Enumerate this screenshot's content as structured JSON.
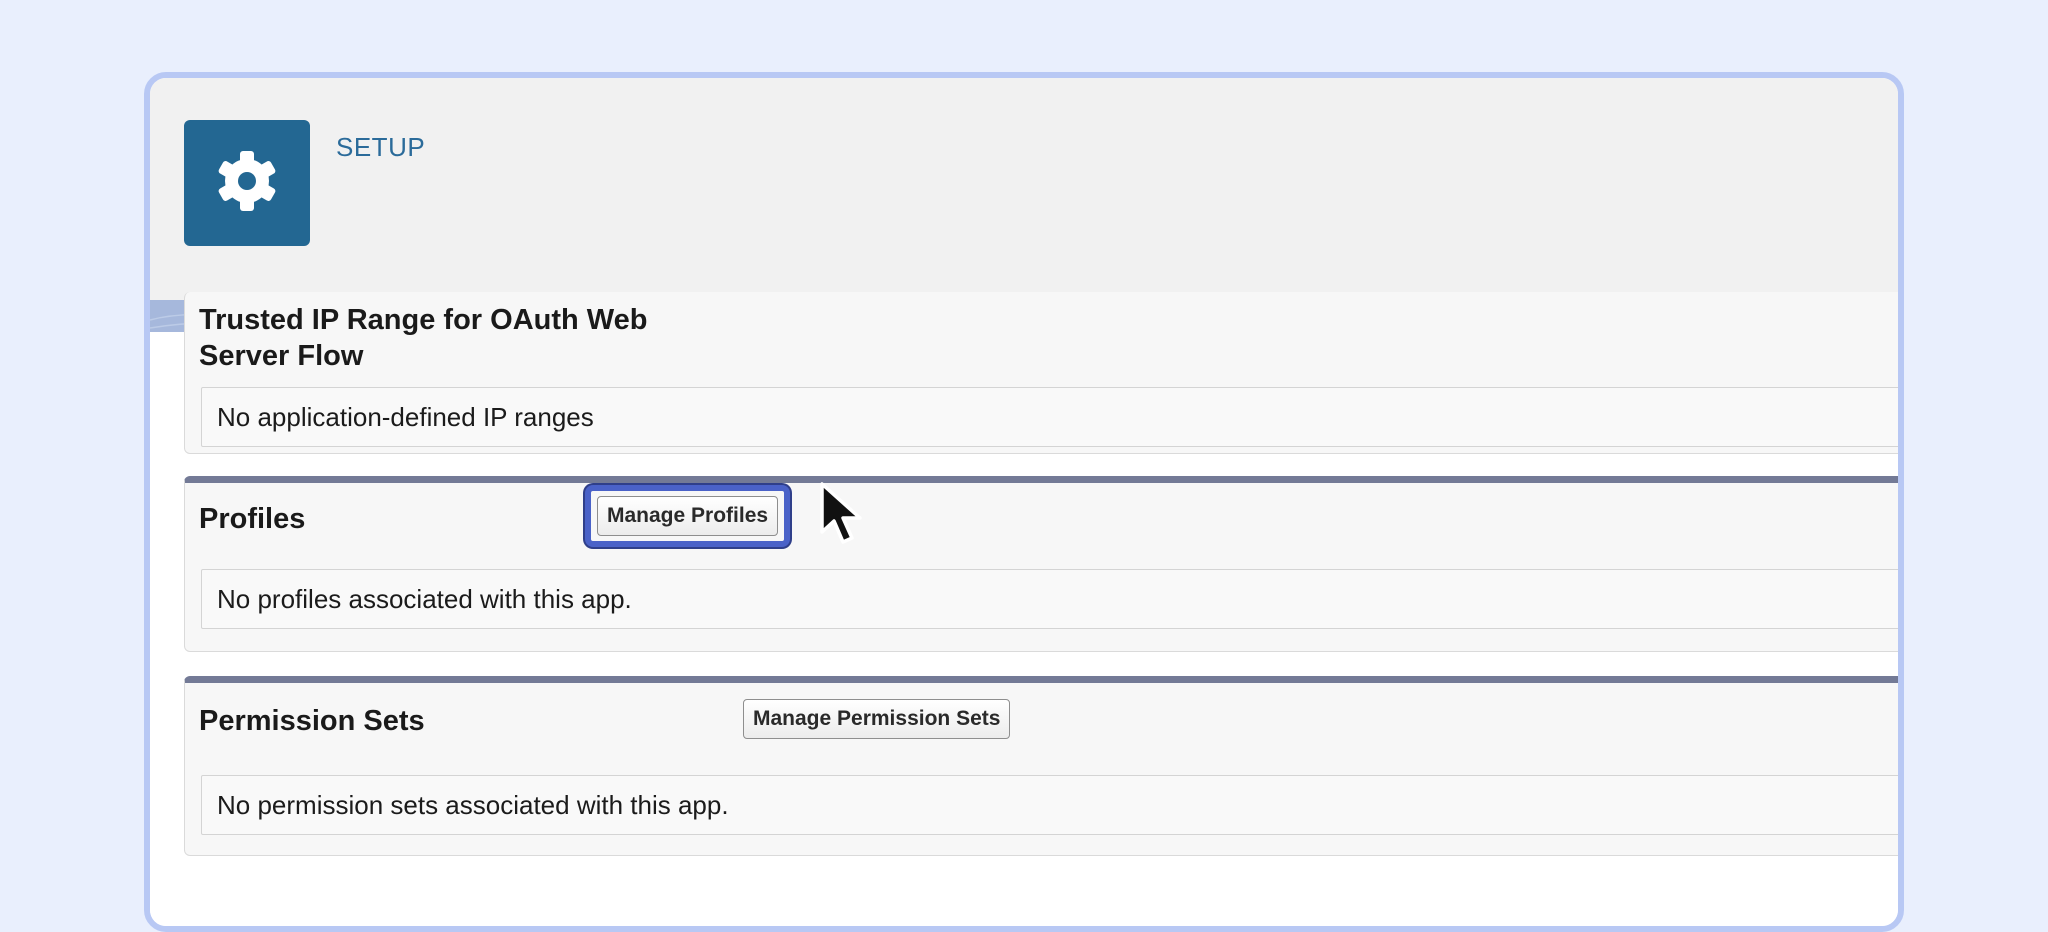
{
  "header": {
    "app_label": "SETUP",
    "app_icon": "gear-icon",
    "tile_color": "#236792"
  },
  "sections": {
    "oauth": {
      "title": "Trusted IP Range for OAuth Web Server Flow",
      "message": "No application-defined IP ranges"
    },
    "profiles": {
      "title": "Profiles",
      "button_label": "Manage Profiles",
      "message": "No profiles associated with this app."
    },
    "permission_sets": {
      "title": "Permission Sets",
      "button_label": "Manage Permission Sets",
      "message": "No permission sets associated with this app."
    }
  },
  "colors": {
    "page_background": "#e9effd",
    "window_border": "#b8c8f4",
    "highlight_ring": "#4a62c8",
    "section_rule": "#737a96"
  }
}
